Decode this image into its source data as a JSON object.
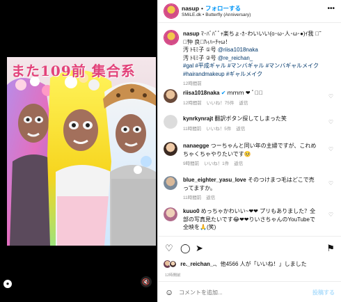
{
  "post": {
    "username": "nasup",
    "follow_label": "フォローする",
    "audio": "SMiLE.dk • Butterfly (Anniversary)",
    "caption_user": "nasup",
    "caption_text": "ﾏ･ﾊﾞﾊﾟﾟｬ楽ちょ-ｶ･わいいい(o･ω･人･ω･●)ｲ我 ｶ̃ｲ̃仲 良ｲ̃ﾊｨﾊｰﾁｬω！",
    "credits": [
      {
        "text": "汚 ﾄﾓﾐ子 ①号 ",
        "tag": "@riisa1018naka"
      },
      {
        "text": "汚 ﾄﾓﾐ子 ②号 ",
        "tag": "@re_reichan_"
      }
    ],
    "hashtags": "#gal #平成ギャル #マンバギャル #マンバギャルメイク #hairandmakeup #ギャルメイク",
    "caption_time": "12時間前"
  },
  "photo_overlay_text": "また109前 集合系",
  "comments": [
    {
      "user": "riisa1018naka",
      "text": "ｍｍｍ ❤ ﾟ✧ﾟ",
      "time": "12時間前",
      "likes": "いいね！75件",
      "reply": "返信"
    },
    {
      "user": "kynrkynrajt",
      "text": "翻訳ボタン探してしまった笑",
      "time": "11時間前",
      "likes": "いいね！5件",
      "reply": "返信"
    },
    {
      "user": "nanaegge",
      "text": "つーちゃんと同い年の主婦ですが、これめちゃくちゃやりたいです🥺",
      "time": "9時間前",
      "likes": "いいね！1件",
      "reply": "返信"
    },
    {
      "user": "blue_eighter_yasu_love",
      "text": "そのつけまつ毛はどこで売ってますか。",
      "time": "11時間前",
      "likes": "",
      "reply": "返信"
    },
    {
      "user": "kuuo0",
      "text": "めっちゃかわいい~❤❤ プリもありました？全部の写真見たいです😂❤❤りいさちゃんのYouTubeで全映を🙏(笑)",
      "time": "12時間前",
      "likes": "",
      "reply": ""
    }
  ],
  "likes": {
    "liker": "re._reichan_.",
    "text": "、他4566 人が「いいね！」しました"
  },
  "posted_time": "12時間前",
  "comment_input": {
    "placeholder": "コメントを追加..."
  },
  "post_button": "投稿する",
  "icons": {
    "more": "more-icon",
    "like": "heart-icon",
    "comment": "comment-icon",
    "share": "send-icon",
    "save": "bookmark-icon",
    "emoji": "emoji-icon",
    "mute": "muted-speaker-icon",
    "user_tag": "person-icon"
  },
  "colors": {
    "accent_link": "#0095f6",
    "hashtag": "#00376b",
    "muted_text": "#8e8e8e"
  }
}
